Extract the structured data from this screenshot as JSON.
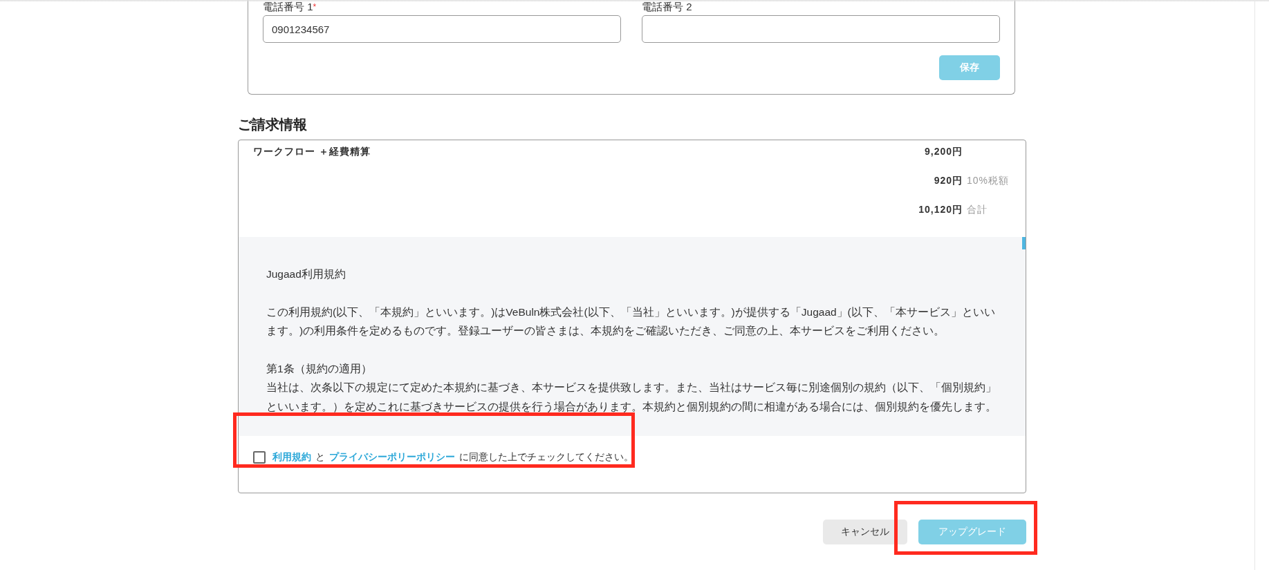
{
  "contact_form": {
    "fields": [
      {
        "label": "電話番号 1",
        "required_mark": "*",
        "value": "0901234567"
      },
      {
        "label": "電話番号 2"
      }
    ],
    "save_button": {
      "label": "保存",
      "disabled": true
    }
  },
  "billing": {
    "title": "ご請求情報",
    "plan": "ワークフロー ＋経費精算",
    "lines": [
      {
        "amount": "9,200円"
      },
      {
        "amount": "920円",
        "note": "10%税額"
      },
      {
        "amount": "10,120円",
        "note": "合計"
      }
    ],
    "terms": {
      "paragraphs": [
        "Jugaad利用規約",
        "この利用規約(以下、「本規約」といいます。)はVeBuln株式会社(以下、「当社」といいます。)が提供する「Jugaad」(以下、「本サービス」といいます。)の利用条件を定めるものです。登録ユーザーの皆さまは、本規約をご確認いただき、ご同意の上、本サービスをご利用ください。",
        "第1条（規約の適用）",
        "当社は、次条以下の規定にて定めた本規約に基づき、本サービスを提供致します。また、当社はサービス毎に別途個別の規約（以下、「個別規約」といいます。）を定めこれに基づきサービスの提供を行う場合があります。本規約と個別規約の間に相違がある場合には、個別規約を優先します。"
      ]
    },
    "agreement": {
      "checked": false,
      "terms_link": "利用規約",
      "joiner": "と",
      "privacy_link": "プライバシーポリーポリシー",
      "suffix": "に同意した上でチェックしてください。"
    }
  },
  "buttons": [
    {
      "kind": "secondary",
      "label": "キャンセル"
    },
    {
      "kind": "primary",
      "label": "アップグレード"
    }
  ]
}
